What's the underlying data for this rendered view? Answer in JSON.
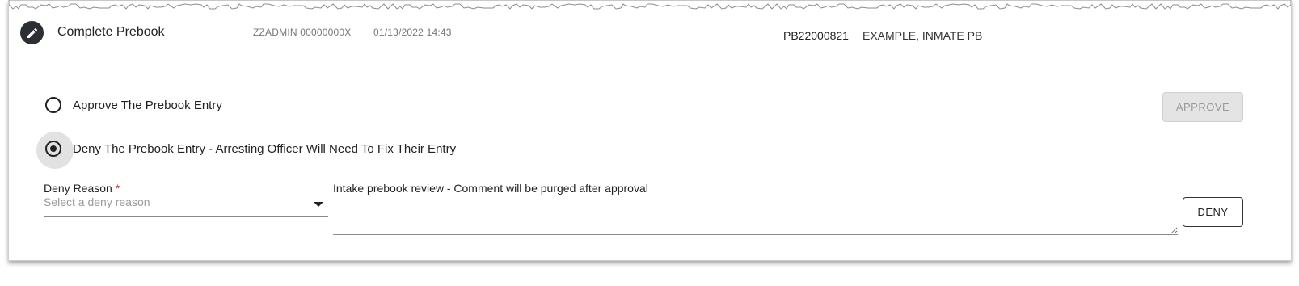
{
  "header": {
    "title": "Complete Prebook",
    "user": "ZZADMIN 00000000X",
    "datetime": "01/13/2022 14:43",
    "booking_number": "PB22000821",
    "inmate_name": "EXAMPLE, INMATE PB",
    "icon": "pencil-icon"
  },
  "options": {
    "approve_label": "Approve The Prebook Entry",
    "deny_label": "Deny The Prebook Entry - Arresting Officer Will Need To Fix Their Entry",
    "selected": "deny"
  },
  "buttons": {
    "approve_label": "APPROVE",
    "deny_label": "DENY"
  },
  "deny_reason": {
    "label": "Deny Reason",
    "required_mark": "*",
    "placeholder": "Select a deny reason",
    "value": ""
  },
  "comment": {
    "label": "Intake prebook review - Comment will be purged after approval",
    "value": ""
  }
}
